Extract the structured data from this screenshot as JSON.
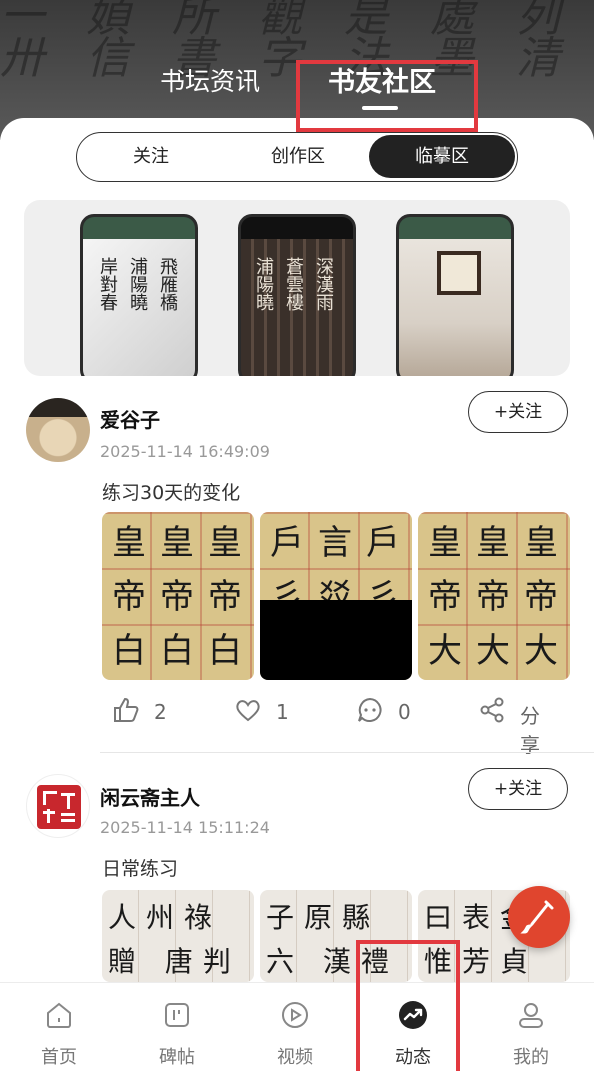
{
  "header": {
    "tabs": [
      {
        "label": "书坛资讯",
        "active": false
      },
      {
        "label": "书友社区",
        "active": true
      }
    ]
  },
  "segments": [
    {
      "label": "关注",
      "active": false
    },
    {
      "label": "创作区",
      "active": false
    },
    {
      "label": "临摹区",
      "active": true
    }
  ],
  "posts": [
    {
      "username": "爱谷子",
      "time": "2025-11-14 16:49:09",
      "follow_label": "+关注",
      "text": "练习30天的变化",
      "likes": "2",
      "favorites": "1",
      "comments": "0",
      "share_label": "分享"
    },
    {
      "username": "闲云斋主人",
      "time": "2025-11-14 15:11:24",
      "follow_label": "+关注",
      "text": "日常练习"
    }
  ],
  "tabbar": [
    {
      "label": "首页",
      "icon": "home-icon",
      "active": false
    },
    {
      "label": "碑帖",
      "icon": "tablet-icon",
      "active": false
    },
    {
      "label": "视频",
      "icon": "play-icon",
      "active": false
    },
    {
      "label": "动态",
      "icon": "trend-icon",
      "active": true
    },
    {
      "label": "我的",
      "icon": "user-icon",
      "active": false
    }
  ],
  "colors": {
    "accent": "#e0452e",
    "highlight": "#e2393f",
    "dark": "#222222"
  }
}
